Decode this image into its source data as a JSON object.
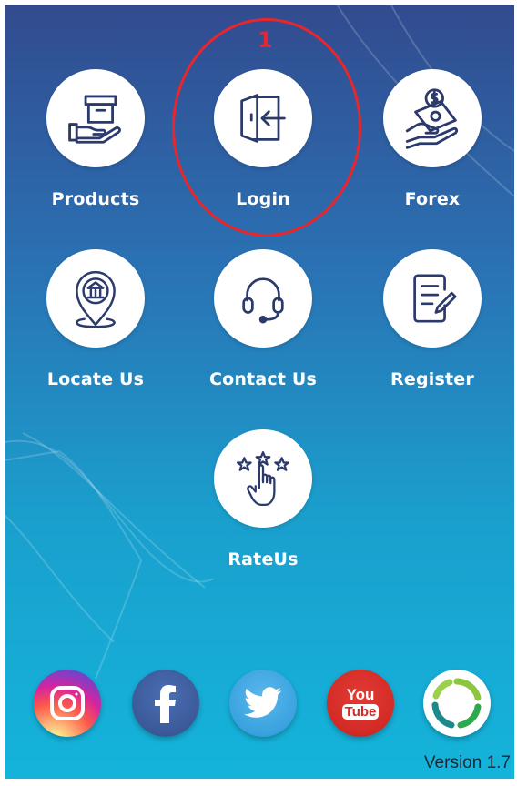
{
  "annotation": {
    "number": "1"
  },
  "menu": {
    "products": {
      "label": "Products"
    },
    "login": {
      "label": "Login"
    },
    "forex": {
      "label": "Forex"
    },
    "locate_us": {
      "label": "Locate Us"
    },
    "contact_us": {
      "label": "Contact Us"
    },
    "register": {
      "label": "Register"
    },
    "rate_us": {
      "label": "RateUs"
    }
  },
  "social": {
    "youtube_top": "You",
    "youtube_bottom": "Tube"
  },
  "footer": {
    "version": "Version 1.7"
  },
  "colors": {
    "icon_navy": "#2b3a6b",
    "annotation_red": "#e8262b",
    "facebook": "#3b5998",
    "twitter": "#3aa2df",
    "youtube": "#d32a25"
  },
  "icons": [
    "box-hand-icon",
    "login-door-icon",
    "money-hand-icon",
    "bank-pin-icon",
    "headset-icon",
    "document-edit-icon",
    "stars-hand-icon",
    "instagram-icon",
    "facebook-icon",
    "twitter-icon",
    "youtube-icon",
    "app-logo-icon"
  ]
}
